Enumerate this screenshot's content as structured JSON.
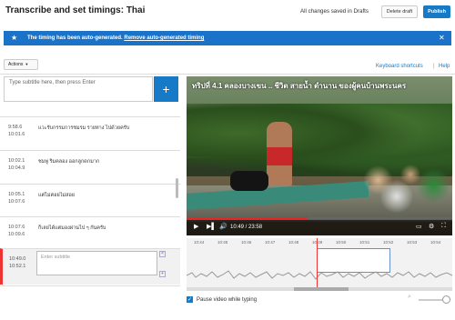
{
  "header": {
    "title": "Transcribe and set timings: Thai",
    "saved_status": "All changes saved in Drafts",
    "delete_draft": "Delete draft",
    "publish": "Publish"
  },
  "banner": {
    "message": "The timing has been auto-generated.",
    "link": "Remove auto-generated timing",
    "close": "✕"
  },
  "toolbar": {
    "actions_label": "Actions",
    "keyboard_shortcuts": "Keyboard shortcuts",
    "help": "Help"
  },
  "editor": {
    "input_placeholder": "Type subtitle here, then press Enter",
    "add_button": "+",
    "subtitles": [
      {
        "start": "9:58.6",
        "end": "10:01.6",
        "text": "แวะรับกรรมการชมรม รายทาง ไปด้วยครับ"
      },
      {
        "start": "10:02.1",
        "end": "10:04.9",
        "text": "ชมพู่ ริมคลอง ออกลูกดกมาก"
      },
      {
        "start": "10:05.1",
        "end": "10:07.6",
        "text": "แต่ไม่ค่อยไม่สอย"
      },
      {
        "start": "10:07.6",
        "end": "10:09.6",
        "text": "ก็เลยได้แต่มองผ่านไป ๆ กันครับ"
      },
      {
        "start": "10:49.0",
        "end": "10:52.1",
        "text": ""
      }
    ],
    "active_placeholder": "Enter subtitle",
    "active_close": "×",
    "active_add": "+"
  },
  "video": {
    "title": "ทริปที่ 4.1 คลองบางเขน .. ชีวิต สายน้ำ ตำนาน ของผู้คนบ้านพระนคร",
    "current_time": "10:49",
    "duration": "23:58",
    "progress": 0.455,
    "play_icon": "▶",
    "next_icon": "▶▌",
    "volume_icon": "🔊",
    "settings_icon": "⚙",
    "cc_icon": "▭",
    "fullscreen_icon": "⛶"
  },
  "timeline": {
    "ticks": [
      "10:44",
      "10:45",
      "10:46",
      "10:47",
      "10:48",
      "10:49",
      "10:50",
      "10:51",
      "10:52",
      "10:53",
      "10:54"
    ]
  },
  "footer": {
    "pause_while_typing": "Pause video while typing",
    "pause_checked": true
  }
}
